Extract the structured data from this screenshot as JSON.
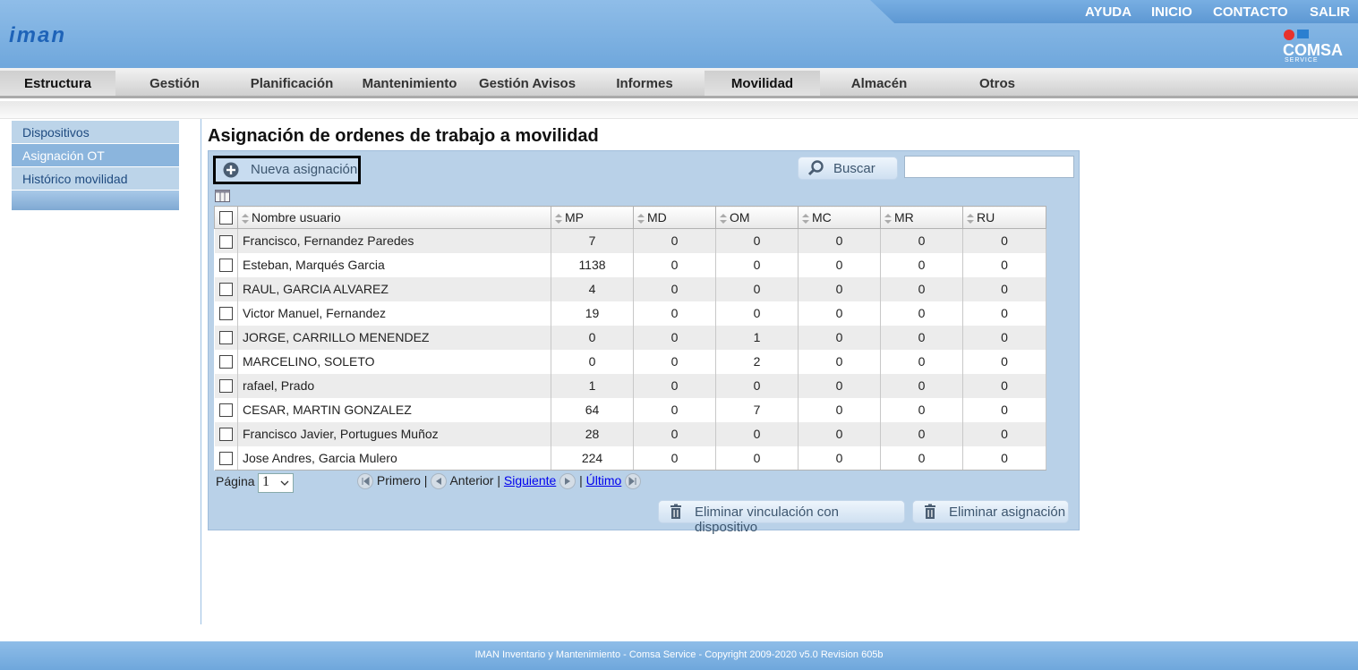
{
  "header": {
    "logo": "iman",
    "top_links": [
      "AYUDA",
      "INICIO",
      "CONTACTO",
      "SALIR"
    ],
    "brand": "COMSA",
    "brand_sub": "SERVICE"
  },
  "nav": {
    "items": [
      "Estructura",
      "Gestión",
      "Planificación",
      "Mantenimiento",
      "Gestión Avisos",
      "Informes",
      "Movilidad",
      "Almacén",
      "Otros"
    ],
    "active": [
      "Estructura",
      "Movilidad"
    ]
  },
  "sidebar": {
    "items": [
      "Dispositivos",
      "Asignación OT",
      "Histórico movilidad"
    ],
    "active": "Asignación OT"
  },
  "page": {
    "title": "Asignación de ordenes de trabajo a movilidad"
  },
  "toolbar": {
    "new_label": "Nueva asignación",
    "search_label": "Buscar",
    "search_value": ""
  },
  "table": {
    "columns": [
      "Nombre usuario",
      "MP",
      "MD",
      "OM",
      "MC",
      "MR",
      "RU"
    ],
    "rows": [
      [
        "Francisco, Fernandez Paredes",
        "7",
        "0",
        "0",
        "0",
        "0",
        "0"
      ],
      [
        "Esteban, Marqués Garcia",
        "1138",
        "0",
        "0",
        "0",
        "0",
        "0"
      ],
      [
        "RAUL, GARCIA ALVAREZ",
        "4",
        "0",
        "0",
        "0",
        "0",
        "0"
      ],
      [
        "Victor Manuel, Fernandez",
        "19",
        "0",
        "0",
        "0",
        "0",
        "0"
      ],
      [
        "JORGE, CARRILLO MENENDEZ",
        "0",
        "0",
        "1",
        "0",
        "0",
        "0"
      ],
      [
        "MARCELINO, SOLETO",
        "0",
        "0",
        "2",
        "0",
        "0",
        "0"
      ],
      [
        "rafael, Prado",
        "1",
        "0",
        "0",
        "0",
        "0",
        "0"
      ],
      [
        "CESAR, MARTIN GONZALEZ",
        "64",
        "0",
        "7",
        "0",
        "0",
        "0"
      ],
      [
        "Francisco Javier, Portugues Muñoz",
        "28",
        "0",
        "0",
        "0",
        "0",
        "0"
      ],
      [
        "Jose Andres, Garcia Mulero",
        "224",
        "0",
        "0",
        "0",
        "0",
        "0"
      ]
    ]
  },
  "pager": {
    "label": "Página",
    "page": "1",
    "first": "Primero",
    "prev": "Anterior",
    "next": "Siguiente",
    "last": "Último"
  },
  "actions": {
    "unlink": "Eliminar vinculación con dispositivo",
    "delete": "Eliminar asignación"
  },
  "footer": {
    "text": "IMAN Inventario y Mantenimiento - Comsa Service - Copyright 2009-2020 v5.0 Revision 605b"
  }
}
